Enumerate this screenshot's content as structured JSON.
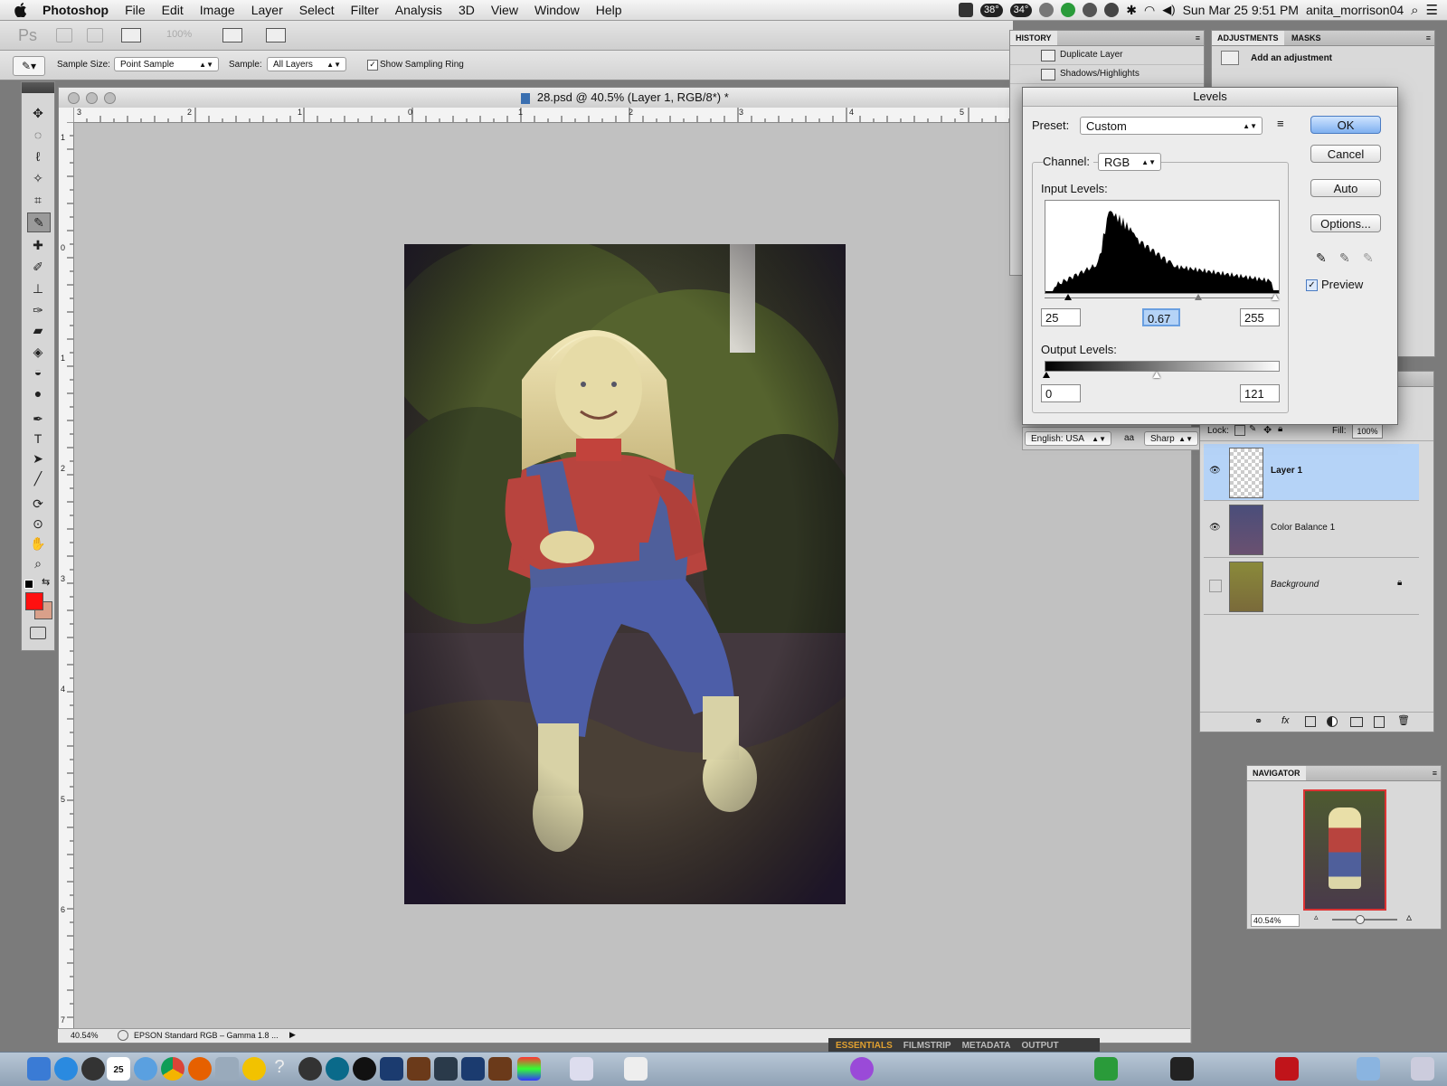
{
  "menubar": {
    "apple": "",
    "app_name": "Photoshop",
    "items": [
      "File",
      "Edit",
      "Image",
      "Layer",
      "Select",
      "Filter",
      "Analysis",
      "3D",
      "View",
      "Window",
      "Help"
    ],
    "temp1": "38°",
    "temp2": "34°",
    "datetime": "Sun Mar 25  9:51 PM",
    "user": "anita_morrison04"
  },
  "appbar": {
    "logo": "Ps",
    "zoom": "100%"
  },
  "options": {
    "sample_size_label": "Sample Size:",
    "sample_size_value": "Point Sample",
    "sample_label": "Sample:",
    "sample_value": "All Layers",
    "show_ring_label": "Show Sampling Ring"
  },
  "document": {
    "title": "28.psd @ 40.5% (Layer 1, RGB/8*) *",
    "zoom_status": "40.54%",
    "profile_status": "EPSON  Standard RGB – Gamma 1.8 ...",
    "hruler": [
      "3",
      "2",
      "1",
      "0",
      "1",
      "2",
      "3",
      "4",
      "5"
    ],
    "vruler": [
      "1",
      "0",
      "1",
      "2",
      "3",
      "4",
      "5",
      "6",
      "7"
    ]
  },
  "history": {
    "tab": "HISTORY",
    "items": [
      "Duplicate Layer",
      "Shadows/Highlights"
    ]
  },
  "adjustments": {
    "tabs": [
      "ADJUSTMENTS",
      "MASKS"
    ],
    "hint": "Add an adjustment"
  },
  "levels": {
    "title": "Levels",
    "preset_label": "Preset:",
    "preset_value": "Custom",
    "channel_label": "Channel:",
    "channel_value": "RGB",
    "input_label": "Input Levels:",
    "input_black": "25",
    "input_gamma": "0.67",
    "input_white": "255",
    "output_label": "Output Levels:",
    "output_black": "0",
    "output_white": "121",
    "buttons": {
      "ok": "OK",
      "cancel": "Cancel",
      "auto": "Auto",
      "options": "Options..."
    },
    "preview_label": "Preview"
  },
  "character": {
    "language": "English: USA",
    "aa_label": "aa",
    "aa_value": "Sharp"
  },
  "layers": {
    "lock_label": "Lock:",
    "fill_label": "Fill:",
    "fill_value": "100%",
    "items": [
      {
        "name": "Layer 1",
        "visible": true,
        "selected": true
      },
      {
        "name": "Color Balance 1",
        "visible": true,
        "selected": false
      },
      {
        "name": "Background",
        "visible": false,
        "selected": false
      }
    ]
  },
  "navigator": {
    "tab": "NAVIGATOR",
    "zoom": "40.54%"
  },
  "bridge": {
    "tabs": [
      "ESSENTIALS",
      "FILMSTRIP",
      "METADATA",
      "OUTPUT"
    ]
  },
  "dock": {
    "badge": "25"
  },
  "colors": {
    "foreground": "#ff1010",
    "background": "#d9a08a",
    "selection": "#b5d3f7"
  }
}
